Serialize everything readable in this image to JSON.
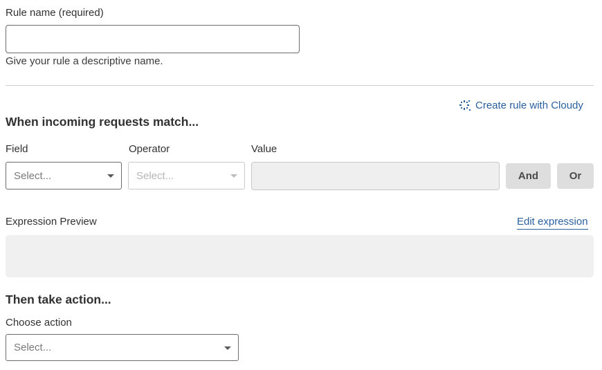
{
  "rule_name": {
    "label": "Rule name (required)",
    "value": "",
    "help": "Give your rule a descriptive name."
  },
  "cloudy_link": {
    "icon": "sparkle-icon",
    "label": "Create rule with Cloudy"
  },
  "match_section": {
    "heading": "When incoming requests match...",
    "field_label": "Field",
    "field_placeholder": "Select...",
    "operator_label": "Operator",
    "operator_placeholder": "Select...",
    "value_label": "Value",
    "value": "",
    "and_label": "And",
    "or_label": "Or"
  },
  "expression": {
    "label": "Expression Preview",
    "edit_label": "Edit expression",
    "value": ""
  },
  "action_section": {
    "heading": "Then take action...",
    "choose_label": "Choose action",
    "placeholder": "Select..."
  },
  "colors": {
    "link": "#2a5f9e",
    "button_bg": "#dedede",
    "preview_bg": "#f0f0f0"
  }
}
